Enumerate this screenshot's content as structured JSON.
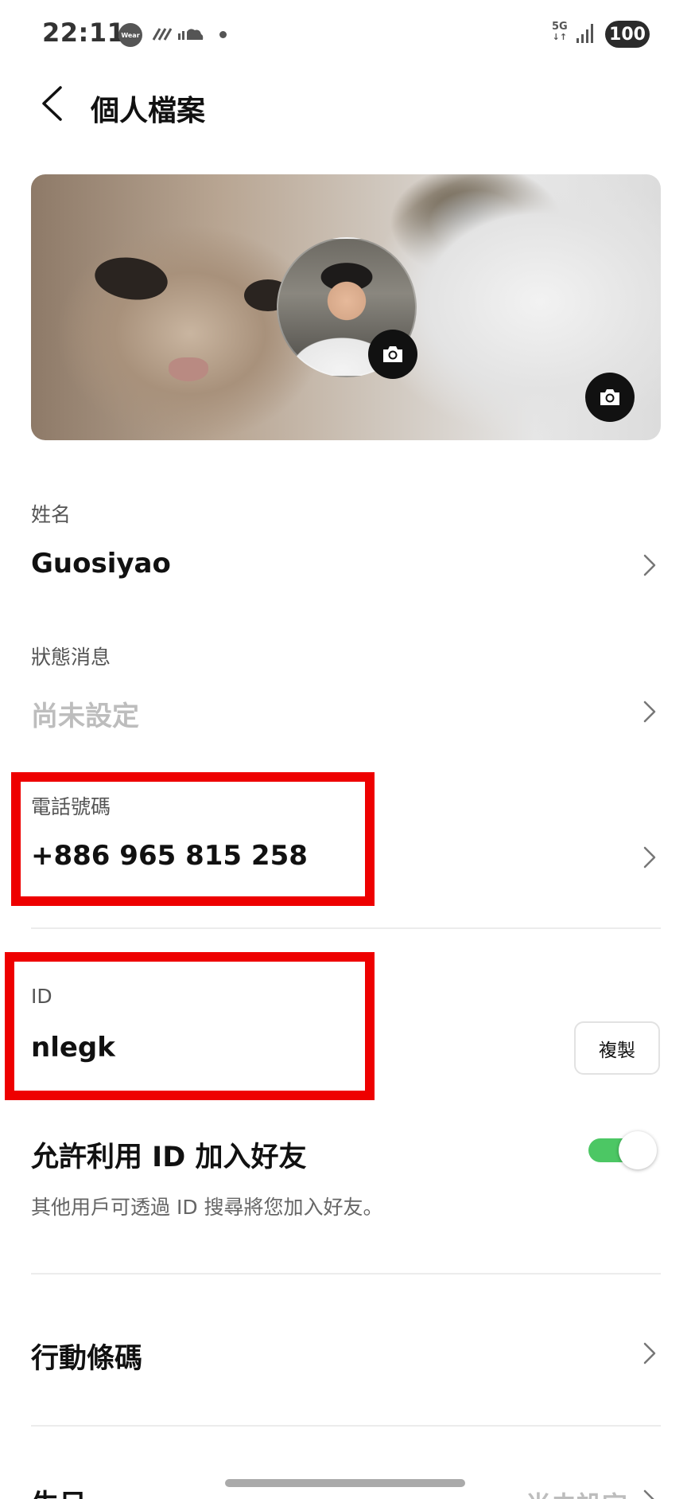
{
  "status_bar": {
    "time": "22:11",
    "wear_label": "Wear",
    "network": "5G",
    "battery": "100"
  },
  "header": {
    "title": "個人檔案"
  },
  "profile": {
    "name_label": "姓名",
    "name_value": "Guosiyao",
    "status_label": "狀態消息",
    "status_value": "尚未設定",
    "phone_label": "電話號碼",
    "phone_value": "+886 965 815 258",
    "id_label": "ID",
    "id_value": "nlegk",
    "copy_label": "複製"
  },
  "id_search": {
    "title": "允許利用 ID 加入好友",
    "description": "其他用戶可透過 ID 搜尋將您加入好友。",
    "enabled": true
  },
  "menu": {
    "qr_code_label": "行動條碼",
    "birthday_label": "生日",
    "birthday_value": "尚未設定"
  },
  "colors": {
    "highlight": "#ee0000",
    "toggle_on": "#4cc764"
  },
  "icons": [
    "back-icon",
    "camera-icon",
    "chevron-right-icon"
  ]
}
